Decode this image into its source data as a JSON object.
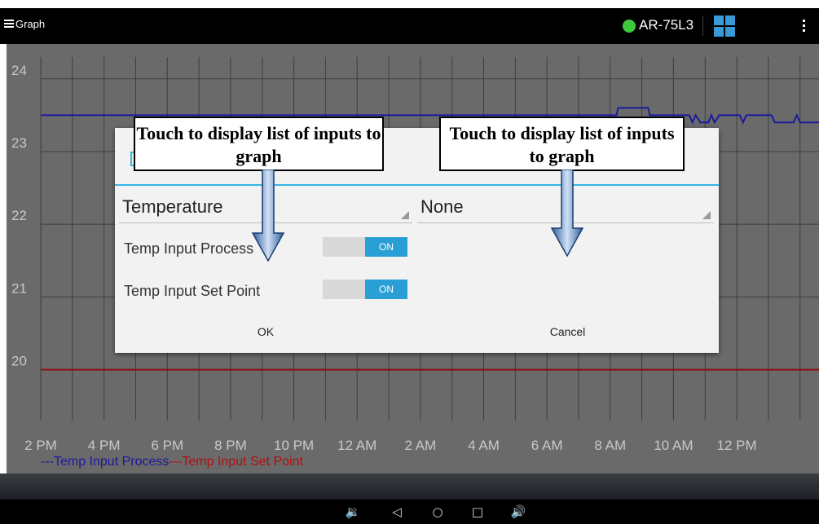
{
  "action_bar": {
    "title": "Graph",
    "device_name": "AR-75L3",
    "status_color": "#3ec83e",
    "icons": [
      "menu-icon",
      "grid-icon",
      "overflow-icon"
    ]
  },
  "chart_data": {
    "type": "line",
    "y_ticks": [
      "24",
      "23",
      "22",
      "21",
      "20"
    ],
    "ylim": [
      19.3,
      24.3
    ],
    "x_ticks": [
      "2 PM",
      "4 PM",
      "6 PM",
      "8 PM",
      "10 PM",
      "12 AM",
      "2 AM",
      "4 AM",
      "6 AM",
      "8 AM",
      "10 AM",
      "12 PM"
    ],
    "xlim": [
      0,
      24.6
    ],
    "grid": true,
    "legend_placement": "bottom-left",
    "series": [
      {
        "name": "Temp Input Process",
        "color": "#1a1a9e",
        "x": [
          0,
          18.2,
          18.25,
          19.2,
          19.25,
          20.5,
          20.6,
          20.7,
          20.85,
          21.1,
          21.2,
          21.3,
          21.45,
          22.1,
          22.2,
          22.3,
          22.45,
          23.1,
          23.2,
          23.8,
          23.9,
          24.0,
          24.1,
          24.2,
          24.6
        ],
        "y": [
          23.5,
          23.5,
          23.6,
          23.6,
          23.5,
          23.5,
          23.4,
          23.5,
          23.4,
          23.4,
          23.5,
          23.4,
          23.5,
          23.5,
          23.4,
          23.5,
          23.5,
          23.5,
          23.4,
          23.4,
          23.5,
          23.4,
          23.4,
          23.4,
          23.4
        ]
      },
      {
        "name": "Temp Input Set Point",
        "color": "#8b1010",
        "x": [
          0,
          24.6
        ],
        "y": [
          20.0,
          20.0
        ]
      }
    ]
  },
  "dialog": {
    "left_spinner": {
      "value": "Temperature"
    },
    "right_spinner": {
      "value": "None"
    },
    "rows": [
      {
        "label": "Temp Input Process",
        "switch": "ON"
      },
      {
        "label": "Temp Input Set Point",
        "switch": "ON"
      }
    ],
    "ok_label": "OK",
    "cancel_label": "Cancel",
    "accent_color": "#33b5e5"
  },
  "annotations": {
    "left_callout": "Touch to display list of inputs to graph",
    "right_callout": "Touch to display list of inputs to graph"
  },
  "nav_bar": {
    "icons": [
      "volume-down-icon",
      "back-icon",
      "home-icon",
      "recents-icon",
      "volume-up-icon"
    ]
  }
}
